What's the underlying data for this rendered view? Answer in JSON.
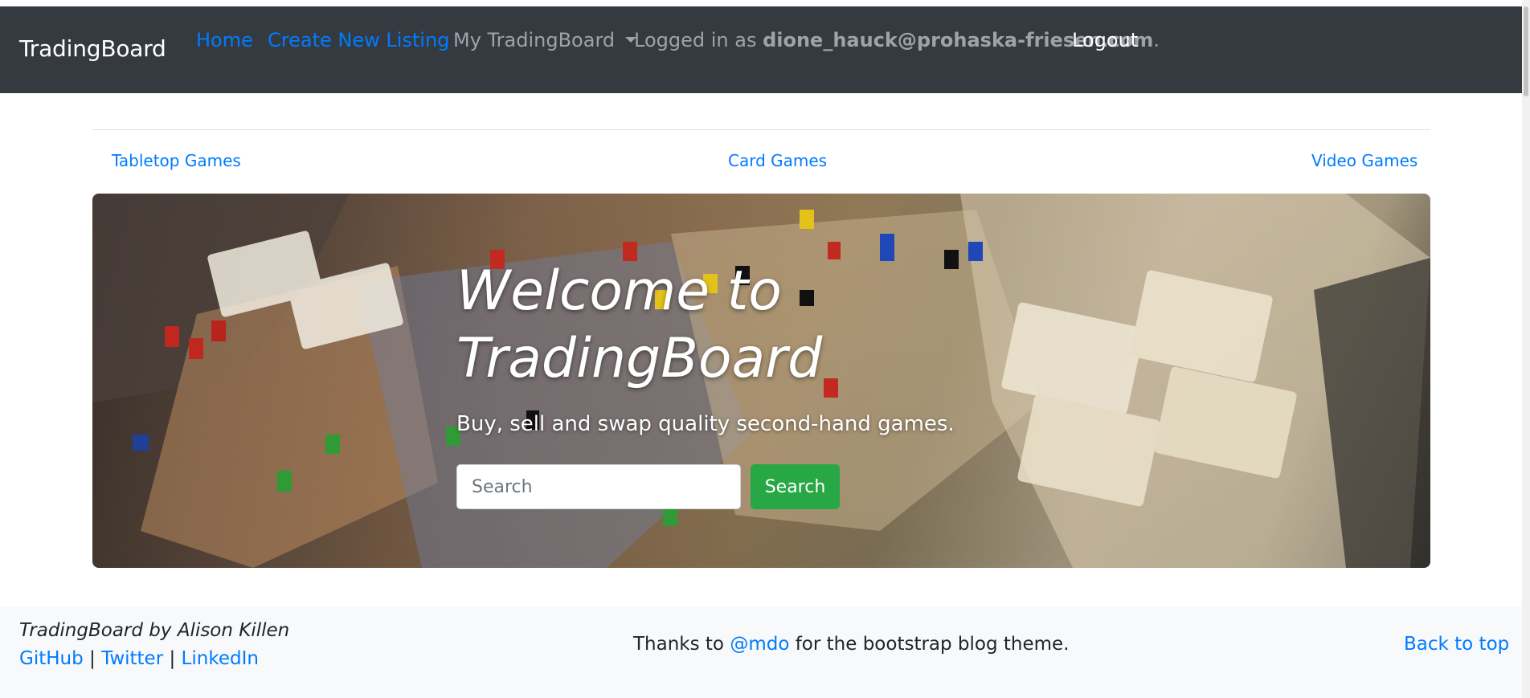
{
  "navbar": {
    "brand": "TradingBoard",
    "links": {
      "home": "Home",
      "create": "Create New Listing",
      "my": "My TradingBoard"
    },
    "logged_in_prefix": "Logged in as ",
    "user_email": "dione_hauck@prohaska-friesen.com",
    "logged_in_suffix": ".",
    "logout": "Logout"
  },
  "categories": [
    "Tabletop Games",
    "Card Games",
    "Video Games"
  ],
  "hero": {
    "title": "Welcome to TradingBoard",
    "subtitle": "Buy, sell and swap quality second-hand games.",
    "search_placeholder": "Search",
    "search_button": "Search"
  },
  "footer": {
    "credit": "TradingBoard by Alison Killen",
    "links": [
      "GitHub",
      "Twitter",
      "LinkedIn"
    ],
    "separator": " | ",
    "thanks_prefix": "Thanks to ",
    "thanks_handle": "@mdo",
    "thanks_suffix": " for the bootstrap blog theme.",
    "back_to_top": "Back to top"
  },
  "colors": {
    "navbar_bg": "#343a40",
    "link": "#007bff",
    "muted": "#9ea3a8",
    "button_success": "#28a745",
    "footer_bg": "#f8f9fa"
  }
}
